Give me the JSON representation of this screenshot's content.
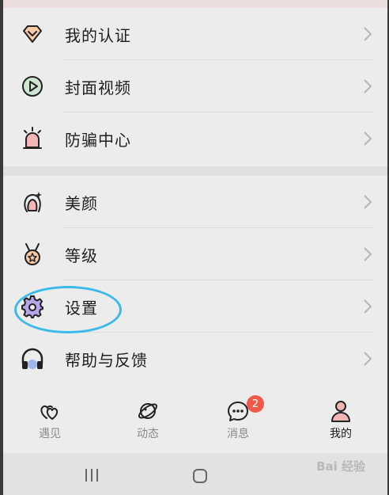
{
  "menu_group_1": [
    {
      "label": "我的认证",
      "icon": "certified-diamond-icon"
    },
    {
      "label": "封面视频",
      "icon": "play-video-icon"
    },
    {
      "label": "防骗中心",
      "icon": "alarm-siren-icon"
    }
  ],
  "menu_group_2": [
    {
      "label": "美颜",
      "icon": "beauty-face-icon"
    },
    {
      "label": "等级",
      "icon": "medal-level-icon"
    },
    {
      "label": "设置",
      "icon": "settings-gear-icon"
    },
    {
      "label": "帮助与反馈",
      "icon": "headphones-help-icon"
    }
  ],
  "tabbar": {
    "tabs": [
      {
        "label": "遇见",
        "icon": "hearts-meet-icon",
        "active": false
      },
      {
        "label": "动态",
        "icon": "planet-moments-icon",
        "active": false
      },
      {
        "label": "消息",
        "icon": "chat-bubble-icon",
        "active": false,
        "badge": "2"
      },
      {
        "label": "我的",
        "icon": "person-profile-icon",
        "active": true
      }
    ]
  },
  "watermark": "Bai 经验",
  "colors": {
    "accent_pink": "#f4b5b5",
    "accent_purple": "#b9a5ea",
    "badge_red": "#f0594a",
    "highlight_blue": "#3bb9ea"
  }
}
